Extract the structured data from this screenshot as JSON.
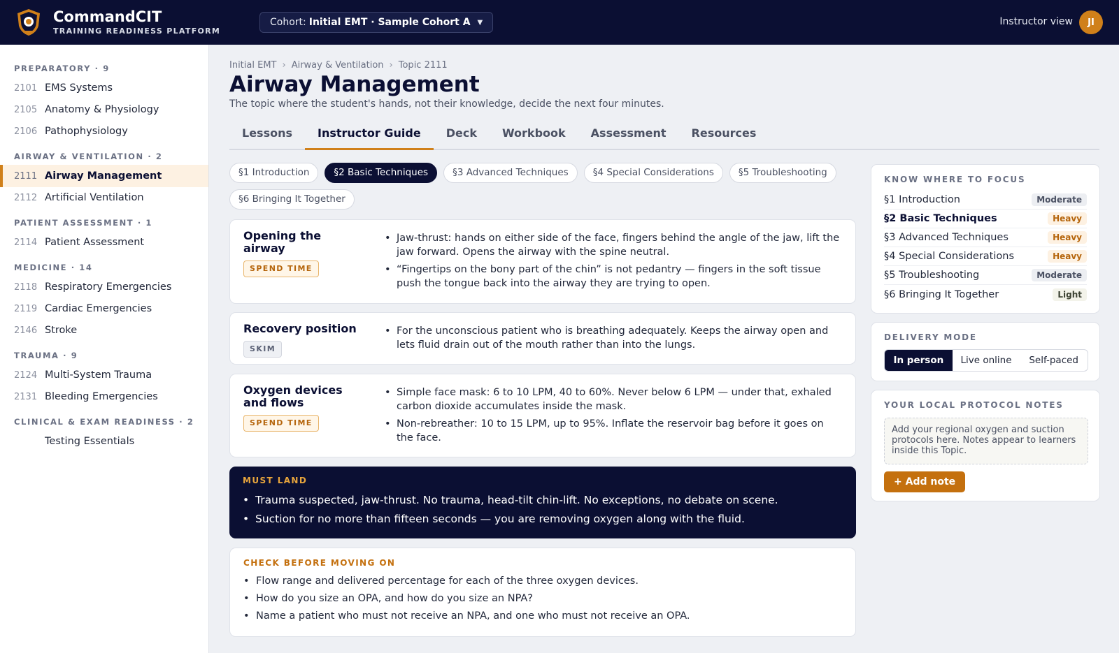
{
  "app": {
    "name": "CommandCIT",
    "subtitle": "TRAINING READINESS PLATFORM",
    "cohort_prefix": "Cohort:",
    "cohort_value": "Initial EMT · Sample Cohort A",
    "view_label": "Instructor view",
    "avatar_initials": "JI"
  },
  "sidebar": [
    {
      "title": "PREPARATORY · 9",
      "items": [
        {
          "num": "2101",
          "label": "EMS Systems"
        },
        {
          "num": "2105",
          "label": "Anatomy & Physiology"
        },
        {
          "num": "2106",
          "label": "Pathophysiology"
        }
      ]
    },
    {
      "title": "AIRWAY & VENTILATION · 2",
      "items": [
        {
          "num": "2111",
          "label": "Airway Management",
          "active": true
        },
        {
          "num": "2112",
          "label": "Artificial Ventilation"
        }
      ]
    },
    {
      "title": "PATIENT ASSESSMENT · 1",
      "items": [
        {
          "num": "2114",
          "label": "Patient Assessment"
        }
      ]
    },
    {
      "title": "MEDICINE · 14",
      "items": [
        {
          "num": "2118",
          "label": "Respiratory Emergencies"
        },
        {
          "num": "2119",
          "label": "Cardiac Emergencies"
        },
        {
          "num": "2146",
          "label": "Stroke"
        }
      ]
    },
    {
      "title": "TRAUMA · 9",
      "items": [
        {
          "num": "2124",
          "label": "Multi-System Trauma"
        },
        {
          "num": "2131",
          "label": "Bleeding Emergencies"
        }
      ]
    },
    {
      "title": "CLINICAL & EXAM READINESS · 2",
      "items": [
        {
          "num": "",
          "label": "Testing Essentials"
        }
      ]
    }
  ],
  "breadcrumb": [
    "Initial EMT",
    "Airway & Ventilation",
    "Topic 2111"
  ],
  "breadcrumb_sep": "›",
  "page": {
    "title": "Airway Management",
    "subtitle": "The topic where the student's hands, not their knowledge, decide the next four minutes."
  },
  "tabs": [
    "Lessons",
    "Instructor Guide",
    "Deck",
    "Workbook",
    "Assessment",
    "Resources"
  ],
  "active_tab": 1,
  "chips": [
    "§1 Introduction",
    "§2 Basic Techniques",
    "§3 Advanced Techniques",
    "§4 Special Considerations",
    "§5 Troubleshooting",
    "§6 Bringing It Together"
  ],
  "active_chip": 1,
  "cards": [
    {
      "title": "Opening the airway",
      "tag": "SPEND TIME",
      "tag_type": "spend",
      "bullets": [
        "Jaw-thrust: hands on either side of the face, fingers behind the angle of the jaw, lift the jaw forward. Opens the airway with the spine neutral.",
        "“Fingertips on the bony part of the chin” is not pedantry — fingers in the soft tissue push the tongue back into the airway they are trying to open."
      ]
    },
    {
      "title": "Recovery position",
      "tag": "SKIM",
      "tag_type": "skim",
      "bullets": [
        "For the unconscious patient who is breathing adequately. Keeps the airway open and lets fluid drain out of the mouth rather than into the lungs."
      ]
    },
    {
      "title": "Oxygen devices and flows",
      "tag": "SPEND TIME",
      "tag_type": "spend",
      "bullets": [
        "Simple face mask: 6 to 10 LPM, 40 to 60%. Never below 6 LPM — under that, exhaled carbon dioxide accumulates inside the mask.",
        "Non-rebreather: 10 to 15 LPM, up to 95%. Inflate the reservoir bag before it goes on the face."
      ]
    }
  ],
  "must_land": {
    "title": "MUST LAND",
    "bullets": [
      "Trauma suspected, jaw-thrust. No trauma, head-tilt chin-lift. No exceptions, no debate on scene.",
      "Suction for no more than fifteen seconds — you are removing oxygen along with the fluid."
    ]
  },
  "check": {
    "title": "CHECK BEFORE MOVING ON",
    "bullets": [
      "Flow range and delivered percentage for each of the three oxygen devices.",
      "How do you size an OPA, and how do you size an NPA?",
      "Name a patient who must not receive an NPA, and one who must not receive an OPA."
    ]
  },
  "focus": {
    "title": "KNOW WHERE TO FOCUS",
    "rows": [
      {
        "label": "§1 Introduction",
        "level": "Moderate"
      },
      {
        "label": "§2 Basic Techniques",
        "level": "Heavy",
        "current": true
      },
      {
        "label": "§3 Advanced Techniques",
        "level": "Heavy"
      },
      {
        "label": "§4 Special Considerations",
        "level": "Heavy"
      },
      {
        "label": "§5 Troubleshooting",
        "level": "Moderate"
      },
      {
        "label": "§6 Bringing It Together",
        "level": "Light"
      }
    ]
  },
  "delivery": {
    "title": "DELIVERY MODE",
    "options": [
      "In person",
      "Live online",
      "Self-paced"
    ],
    "selected": 0
  },
  "notes": {
    "title": "YOUR LOCAL PROTOCOL NOTES",
    "placeholder": "Add your regional oxygen and suction protocols here. Notes appear to learners inside this Topic.",
    "add_label": "+ Add note"
  },
  "colors": {
    "navy": "#0b0f33",
    "accent": "#d0801a"
  },
  "icons": {
    "logo": "shield-crest-icon",
    "cohort_dropdown": "caret-down-icon"
  }
}
